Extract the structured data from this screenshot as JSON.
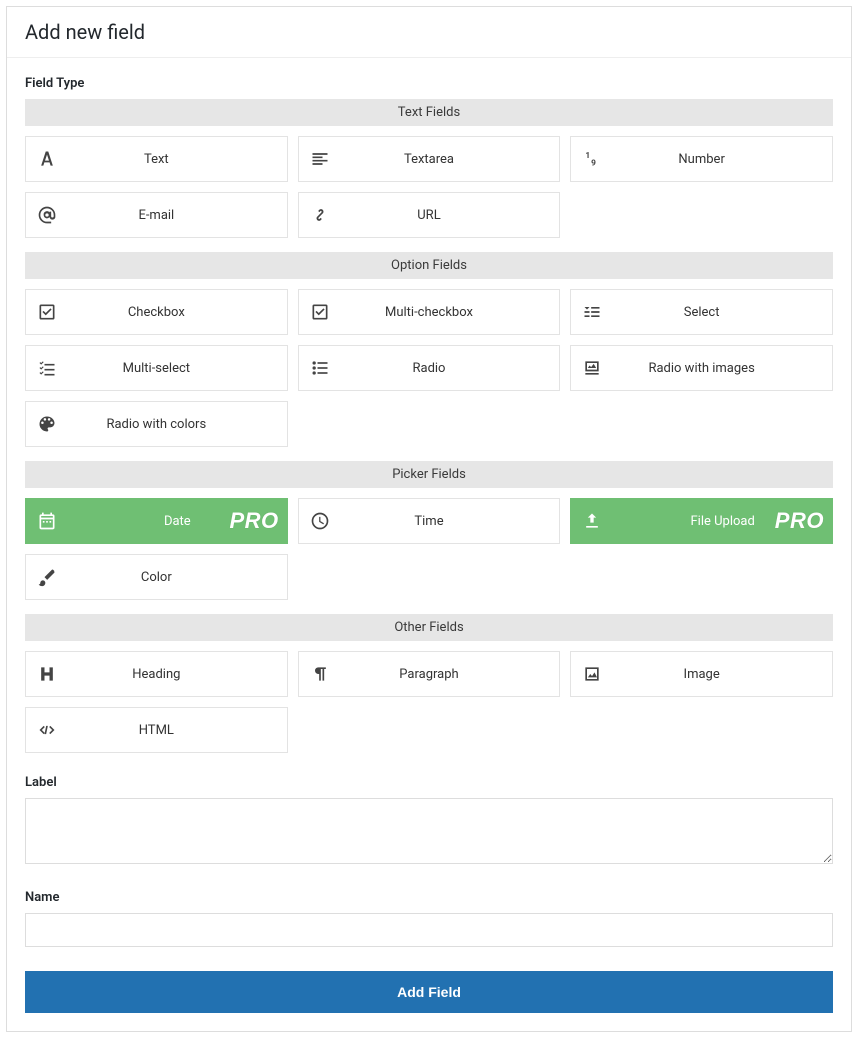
{
  "header": {
    "title": "Add new field"
  },
  "sections": {
    "fieldTypeLabel": "Field Type",
    "labelLabel": "Label",
    "nameLabel": "Name"
  },
  "groups": {
    "text": {
      "title": "Text Fields",
      "items": {
        "text": "Text",
        "textarea": "Textarea",
        "number": "Number",
        "email": "E-mail",
        "url": "URL"
      }
    },
    "option": {
      "title": "Option Fields",
      "items": {
        "checkbox": "Checkbox",
        "multicheckbox": "Multi-checkbox",
        "select": "Select",
        "multiselect": "Multi-select",
        "radio": "Radio",
        "radioimages": "Radio with images",
        "radiocolors": "Radio with colors"
      }
    },
    "picker": {
      "title": "Picker Fields",
      "items": {
        "date": "Date",
        "time": "Time",
        "fileupload": "File Upload",
        "color": "Color"
      }
    },
    "other": {
      "title": "Other Fields",
      "items": {
        "heading": "Heading",
        "paragraph": "Paragraph",
        "image": "Image",
        "html": "HTML"
      }
    }
  },
  "pro_badge": "PRO",
  "form": {
    "label_value": "",
    "name_value": ""
  },
  "submit": {
    "label": "Add Field"
  },
  "colors": {
    "accent": "#2271b1",
    "pro": "#6fbf73"
  }
}
